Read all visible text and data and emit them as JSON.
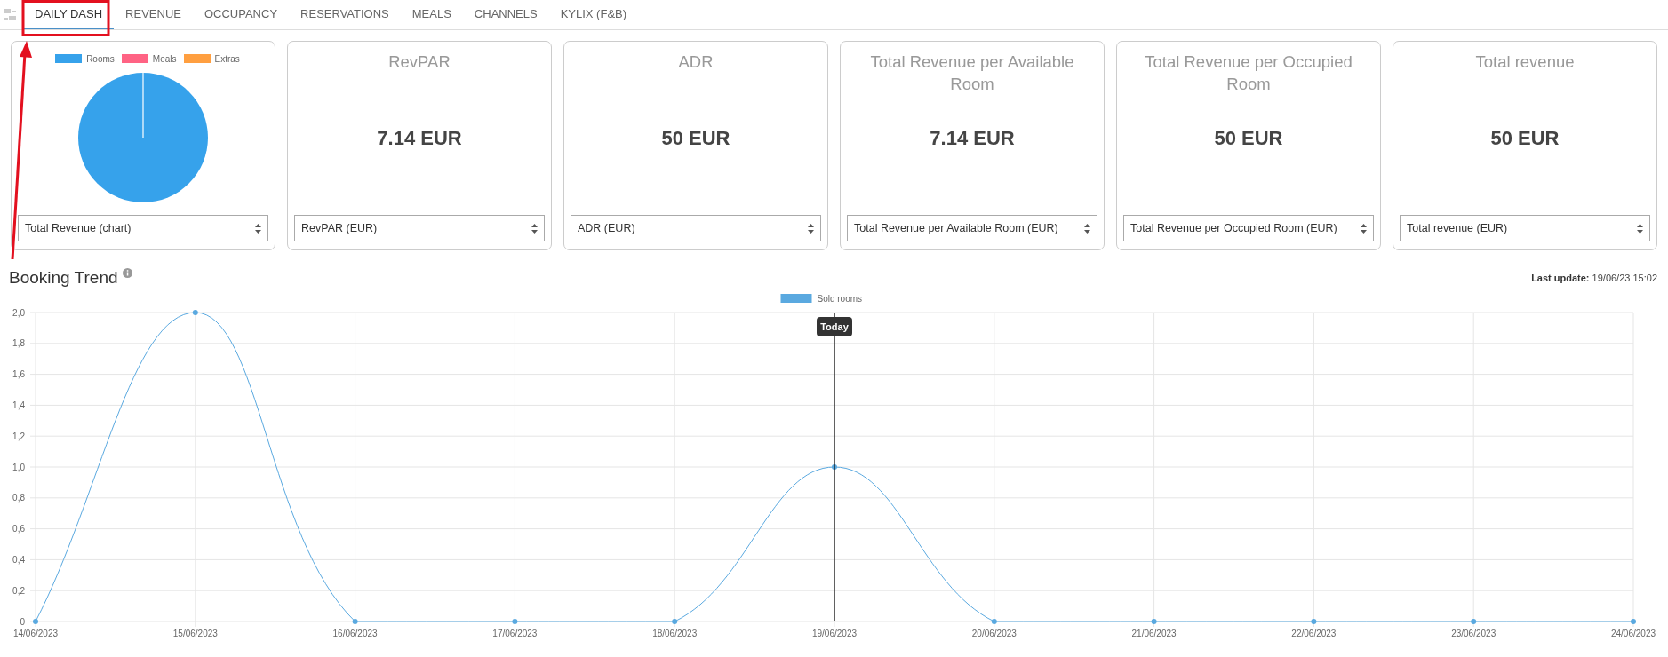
{
  "tabs": [
    {
      "label": "DAILY DASH",
      "selected": true
    },
    {
      "label": "REVENUE",
      "selected": false
    },
    {
      "label": "OCCUPANCY",
      "selected": false
    },
    {
      "label": "RESERVATIONS",
      "selected": false
    },
    {
      "label": "MEALS",
      "selected": false
    },
    {
      "label": "CHANNELS",
      "selected": false
    },
    {
      "label": "KYLIX (F&B)",
      "selected": false
    }
  ],
  "cards": [
    {
      "kind": "pie",
      "legend": [
        {
          "label": "Rooms",
          "color": "#36a2eb"
        },
        {
          "label": "Meals",
          "color": "#ff6384"
        },
        {
          "label": "Extras",
          "color": "#ff9f40"
        }
      ],
      "select": "Total Revenue (chart)"
    },
    {
      "kind": "metric",
      "title": "RevPAR",
      "value": "7.14 EUR",
      "select": "RevPAR (EUR)"
    },
    {
      "kind": "metric",
      "title": "ADR",
      "value": "50 EUR",
      "select": "ADR (EUR)"
    },
    {
      "kind": "metric",
      "title": "Total Revenue per Available Room",
      "value": "7.14 EUR",
      "select": "Total Revenue per Available Room (EUR)"
    },
    {
      "kind": "metric",
      "title": "Total Revenue per Occupied Room",
      "value": "50 EUR",
      "select": "Total Revenue per Occupied Room (EUR)"
    },
    {
      "kind": "metric",
      "title": "Total revenue",
      "value": "50 EUR",
      "select": "Total revenue (EUR)"
    }
  ],
  "booking_trend": {
    "title": "Booking Trend",
    "last_update_label": "Last update:",
    "last_update": "19/06/23 15:02",
    "chart_data": {
      "type": "line",
      "categories": [
        "14/06/2023",
        "15/06/2023",
        "16/06/2023",
        "17/06/2023",
        "18/06/2023",
        "19/06/2023",
        "20/06/2023",
        "21/06/2023",
        "22/06/2023",
        "23/06/2023",
        "24/06/2023"
      ],
      "series": [
        {
          "name": "Sold rooms",
          "color": "#5aa9e0",
          "marker": "circle",
          "values": [
            0,
            2,
            0,
            0,
            0,
            1,
            0,
            0,
            0,
            0,
            0
          ]
        }
      ],
      "grid": true,
      "ref_lines": [
        {
          "axis": "x",
          "value": "19/06/2023",
          "color": "#111111"
        }
      ],
      "ylim": [
        0,
        2
      ],
      "yticks": [
        {
          "value": 0,
          "label": "0"
        },
        {
          "value": 0.2,
          "label": "0,2"
        },
        {
          "value": 0.4,
          "label": "0,4"
        },
        {
          "value": 0.6,
          "label": "0,6"
        },
        {
          "value": 0.8,
          "label": "0,8"
        },
        {
          "value": 1,
          "label": "1,0"
        },
        {
          "value": 1.2,
          "label": "1,2"
        },
        {
          "value": 1.4,
          "label": "1,4"
        },
        {
          "value": 1.6,
          "label": "1,6"
        },
        {
          "value": 1.8,
          "label": "1,8"
        },
        {
          "value": 2,
          "label": "2,0"
        }
      ],
      "annotations": [
        {
          "x": "19/06/2023",
          "text": "Today"
        }
      ]
    }
  }
}
